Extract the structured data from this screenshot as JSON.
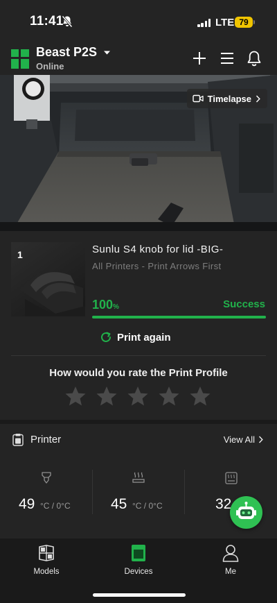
{
  "status_bar": {
    "time": "11:41",
    "network": "LTE",
    "battery": "79",
    "icons": [
      "bell-slash-icon",
      "signal-icon",
      "battery-icon"
    ]
  },
  "header": {
    "printer_name": "Beast P2S",
    "printer_status": "Online",
    "icons": [
      "logo-icon",
      "chevron-down-icon",
      "plus-icon",
      "menu-icon",
      "bell-icon"
    ]
  },
  "camera": {
    "timelapse_label": "Timelapse"
  },
  "job": {
    "thumbnail_index": "1",
    "title": "Sunlu S4 knob for lid -BIG-",
    "subtitle": "All Printers - Print Arrows First",
    "progress_value": "100",
    "progress_unit": "%",
    "progress_fraction": 1.0,
    "status": "Success",
    "print_again_label": "Print again",
    "rating_prompt": "How would you rate the Print Profile",
    "star_count": 5,
    "rating": 0
  },
  "printer_panel": {
    "label": "Printer",
    "view_all_label": "View All",
    "temps": [
      {
        "icon": "nozzle-icon",
        "value": "49",
        "unit": "°C / 0°C"
      },
      {
        "icon": "heatbed-icon",
        "value": "45",
        "unit": "°C / 0°C"
      },
      {
        "icon": "chamber-icon",
        "value": "32"
      }
    ]
  },
  "tabbar": {
    "items": [
      {
        "label": "Models",
        "icon": "models-icon"
      },
      {
        "label": "Devices",
        "icon": "devices-icon",
        "active": true
      },
      {
        "label": "Me",
        "icon": "person-icon"
      }
    ]
  },
  "colors": {
    "accent": "#21b24b",
    "background": "#242424",
    "tabbar": "#1a1a1a",
    "battery": "#f0c400"
  }
}
